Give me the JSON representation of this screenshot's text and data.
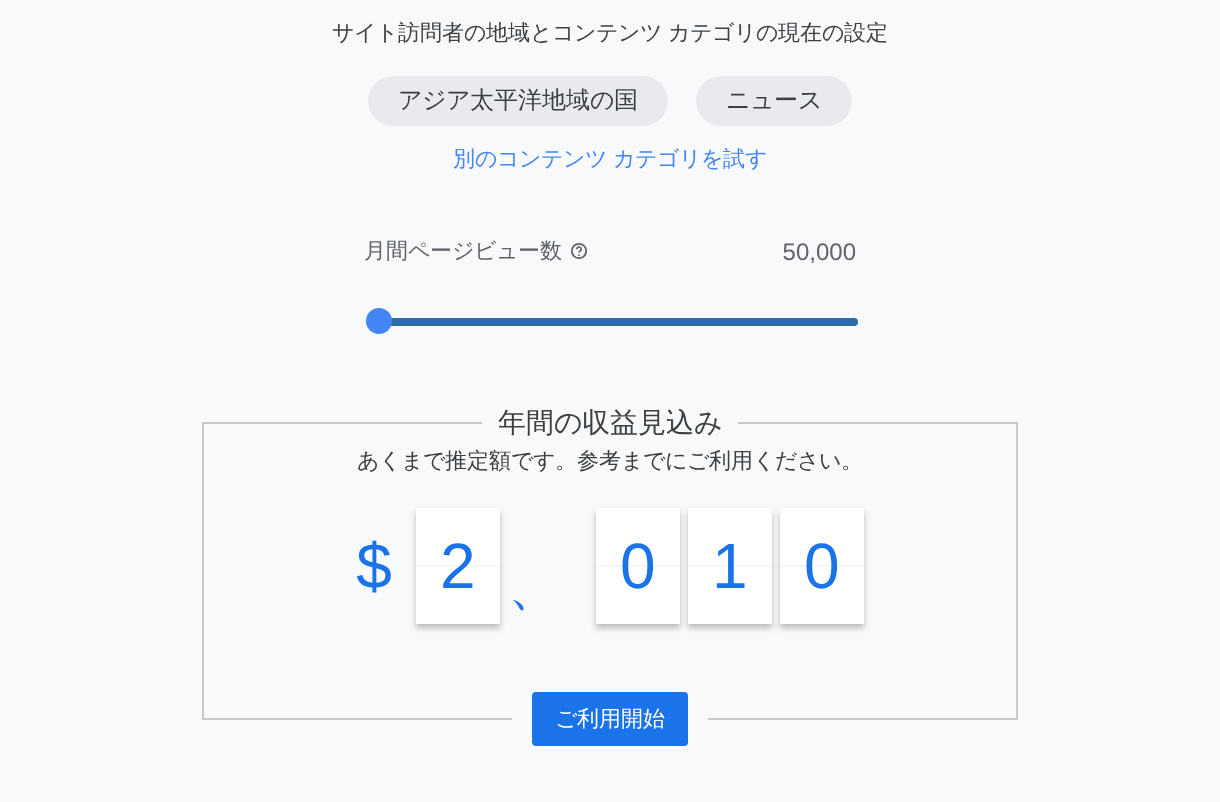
{
  "heading": "サイト訪問者の地域とコンテンツ カテゴリの現在の設定",
  "chips": [
    {
      "label": "アジア太平洋地域の国"
    },
    {
      "label": "ニュース"
    }
  ],
  "link": "別のコンテンツ カテゴリを試す",
  "slider": {
    "label": "月間ページビュー数",
    "value": "50,000",
    "level": 0
  },
  "estimate": {
    "title": "年間の収益見込み",
    "note": "あくまで推定額です。参考までにご利用ください。",
    "digits": [
      {
        "kind": "symbol",
        "text": "$"
      },
      {
        "kind": "digit",
        "text": "2"
      },
      {
        "kind": "separator",
        "text": "、"
      },
      {
        "kind": "digit",
        "text": "0"
      },
      {
        "kind": "digit",
        "text": "1"
      },
      {
        "kind": "digit",
        "text": "0"
      }
    ]
  },
  "button": "ご利用開始"
}
